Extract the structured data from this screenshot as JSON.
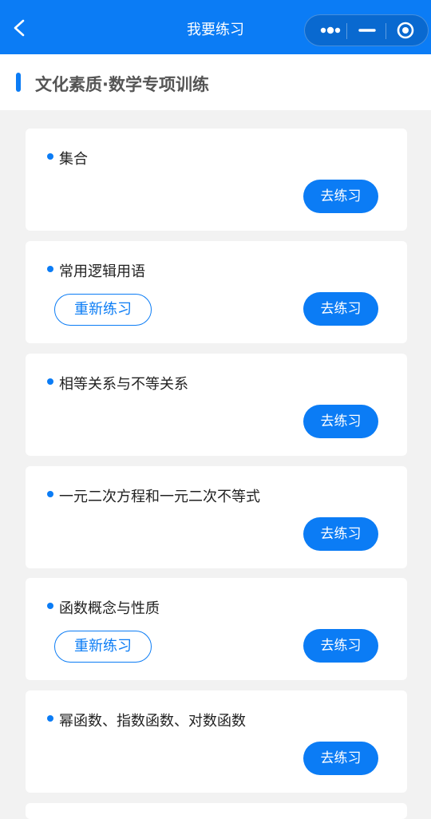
{
  "nav": {
    "title": "我要练习"
  },
  "section": {
    "title": "文化素质·数学专项训练"
  },
  "practice_label": "去练习",
  "redo_label": "重新练习",
  "topics": [
    {
      "title": "集合",
      "has_redo": false
    },
    {
      "title": "常用逻辑用语",
      "has_redo": true
    },
    {
      "title": "相等关系与不等关系",
      "has_redo": false
    },
    {
      "title": "一元二次方程和一元二次不等式",
      "has_redo": false
    },
    {
      "title": "函数概念与性质",
      "has_redo": true
    },
    {
      "title": "幂函数、指数函数、对数函数",
      "has_redo": false
    }
  ],
  "colors": {
    "accent": "#0b7cf5",
    "background": "#f2f2f2",
    "card": "#ffffff"
  },
  "icons": [
    "back-arrow-icon",
    "more-dots-icon",
    "minimize-icon",
    "close-target-icon"
  ]
}
